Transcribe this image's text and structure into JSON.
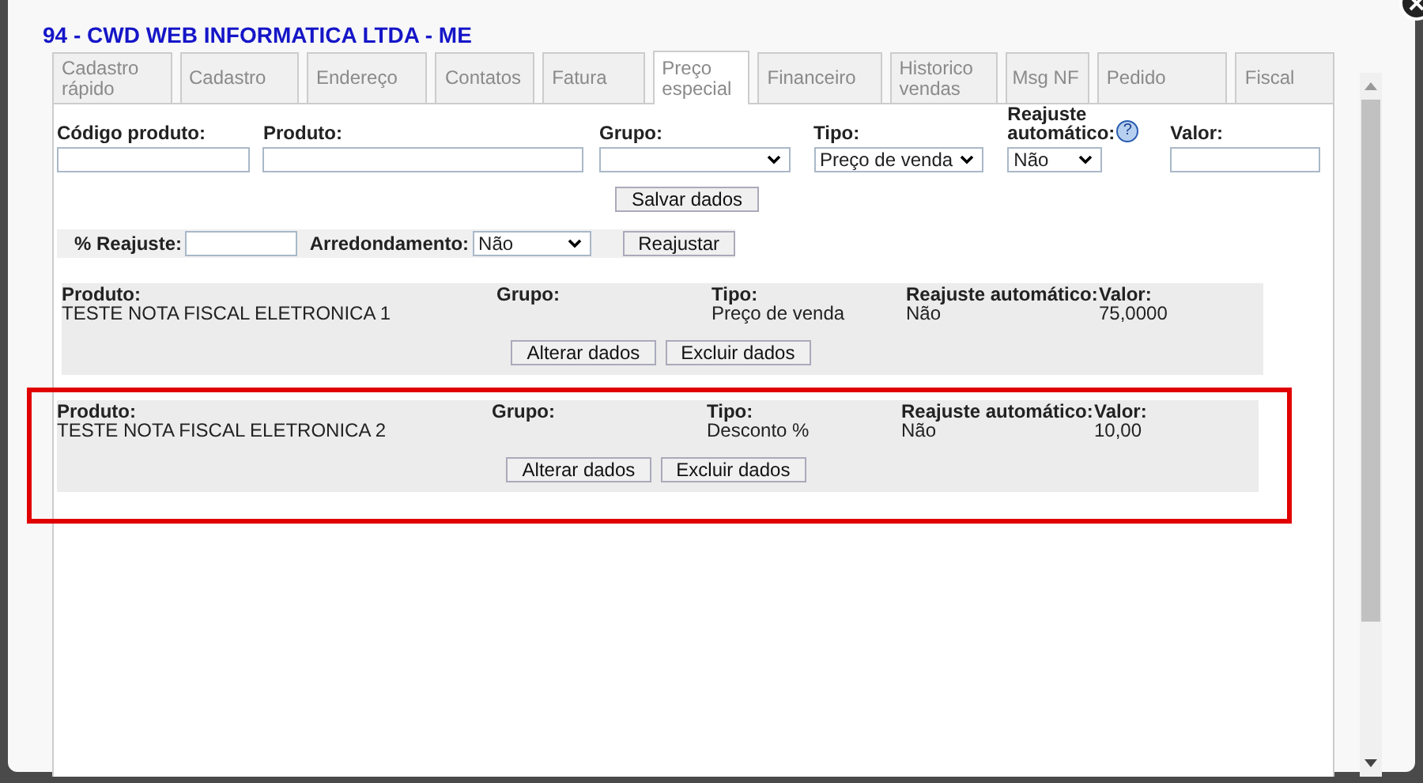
{
  "window": {
    "title": "94 - CWD WEB INFORMATICA LTDA - ME"
  },
  "tabs": [
    {
      "label": "Cadastro rápido",
      "selected": false
    },
    {
      "label": "Cadastro",
      "selected": false
    },
    {
      "label": "Endereço",
      "selected": false
    },
    {
      "label": "Contatos",
      "selected": false
    },
    {
      "label": "Fatura",
      "selected": false
    },
    {
      "label": "Preço especial",
      "selected": true
    },
    {
      "label": "Financeiro",
      "selected": false
    },
    {
      "label": "Historico vendas",
      "selected": false
    },
    {
      "label": "Msg NF",
      "selected": false
    },
    {
      "label": "Pedido",
      "selected": false
    },
    {
      "label": "Fiscal",
      "selected": false
    }
  ],
  "form": {
    "fields": [
      {
        "kind": "input",
        "label": "Código produto:"
      },
      {
        "kind": "input",
        "label": "Produto:"
      },
      {
        "kind": "select",
        "label": "Grupo:"
      },
      {
        "kind": "select",
        "label": "Tipo:",
        "value": "Preço de venda"
      },
      {
        "kind": "select",
        "label": "Reajuste automático:",
        "value": "Não",
        "help": "?"
      },
      {
        "kind": "input",
        "label": "Valor:"
      }
    ],
    "save_button": "Salvar dados"
  },
  "adjust": {
    "percent_label": "% Reajuste:",
    "rounding_label": "Arredondamento:",
    "rounding_value": "Não",
    "button": "Reajustar"
  },
  "records": [
    {
      "columns": [
        {
          "label": "Produto:",
          "value": "TESTE NOTA FISCAL ELETRONICA 1"
        },
        {
          "label": "Grupo:"
        },
        {
          "label": "Tipo:",
          "value": "Preço de venda"
        },
        {
          "label": "Reajuste automático:",
          "value": "Não"
        },
        {
          "label": "Valor:",
          "value": "75,0000"
        }
      ],
      "buttons": [
        "Alterar dados",
        "Excluir dados"
      ],
      "highlighted": false
    },
    {
      "columns": [
        {
          "label": "Produto:",
          "value": "TESTE NOTA FISCAL ELETRONICA 2"
        },
        {
          "label": "Grupo:"
        },
        {
          "label": "Tipo:",
          "value": "Desconto %"
        },
        {
          "label": "Reajuste automático:",
          "value": "Não"
        },
        {
          "label": "Valor:",
          "value": "10,00"
        }
      ],
      "buttons": [
        "Alterar dados",
        "Excluir dados"
      ],
      "highlighted": true
    }
  ]
}
